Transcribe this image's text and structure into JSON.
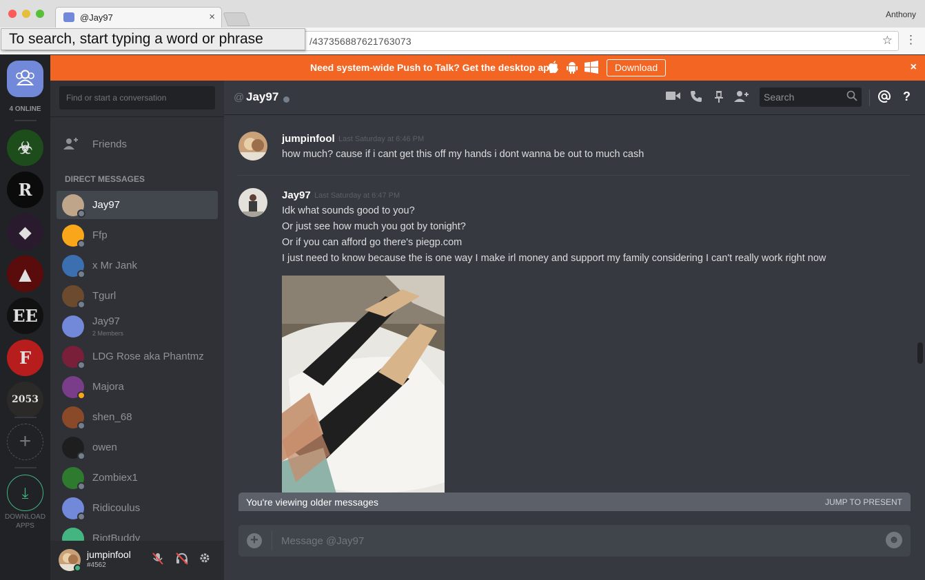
{
  "browser": {
    "tab_title": "@Jay97",
    "tab_close": "×",
    "profile_name": "Anthony",
    "url": "/437356887621763073",
    "find_tooltip": "To search, start typing a word or phrase",
    "star": "☆",
    "menu": "⋮"
  },
  "guilds": {
    "online_label": "4 ONLINE",
    "items": [
      {
        "name": "biohazard-guild",
        "color": "#1d4d1a",
        "glyph": "☣"
      },
      {
        "name": "r-guild",
        "color": "#0b0b0b",
        "glyph": "R"
      },
      {
        "name": "wolf-guild",
        "color": "#2a1a2e",
        "glyph": "◆"
      },
      {
        "name": "red-cape-guild",
        "color": "#5a0b0b",
        "glyph": "▲"
      },
      {
        "name": "ee-guild",
        "color": "#111111",
        "glyph": "EE"
      },
      {
        "name": "f-guild",
        "color": "#b81d1d",
        "glyph": "F"
      },
      {
        "name": "2053-guild",
        "color": "#2b2a28",
        "glyph": "2053"
      }
    ],
    "add_icon": "+",
    "download_icon": "⤓",
    "download_label_1": "DOWNLOAD",
    "download_label_2": "APPS"
  },
  "banner": {
    "text": "Need system-wide Push to Talk? Get the desktop app!",
    "download_label": "Download",
    "close": "×",
    "bg": "#f26522"
  },
  "sidebar": {
    "search_placeholder": "Find or start a conversation",
    "friends_label": "Friends",
    "dm_header": "DIRECT MESSAGES",
    "items": [
      {
        "name": "Jay97",
        "color": "#bfa58a",
        "status": "#747f8d",
        "active": true
      },
      {
        "name": "Ffp",
        "color": "#faa61a",
        "status": "#747f8d"
      },
      {
        "name": "x Mr Jank",
        "color": "#3b6fb0",
        "status": "#747f8d"
      },
      {
        "name": "Tgurl",
        "color": "#6b4a2e",
        "status": "#747f8d"
      },
      {
        "name": "Jay97",
        "sub": "2 Members",
        "color": "#7289da",
        "status": ""
      },
      {
        "name": "LDG Rose aka Phantmz",
        "color": "#7a1f3a",
        "status": "#747f8d"
      },
      {
        "name": "Majora",
        "color": "#7a3d8a",
        "status": "#faa61a"
      },
      {
        "name": "shen_68",
        "color": "#8a4a2a",
        "status": "#747f8d"
      },
      {
        "name": "owen",
        "color": "#1e1e1e",
        "status": "#747f8d"
      },
      {
        "name": "Zombiex1",
        "color": "#2e7a2e",
        "status": "#747f8d"
      },
      {
        "name": "Ridicoulus",
        "color": "#7289da",
        "status": "#747f8d"
      },
      {
        "name": "RiotBuddy",
        "color": "#43b581",
        "status": "#747f8d"
      }
    ]
  },
  "user_panel": {
    "username": "jumpinfool",
    "tag": "#4562",
    "status_color": "#43b581"
  },
  "header": {
    "at": "@",
    "title": "Jay97",
    "search_placeholder": "Search",
    "icons": [
      "video-icon",
      "phone-icon",
      "pin-icon",
      "add-member-icon",
      "mention-icon",
      "help-icon"
    ]
  },
  "messages": [
    {
      "author": "jumpinfool",
      "time": "Last Saturday at 6:46 PM",
      "lines": [
        "how much? cause if i cant get this off my hands i dont wanna be out to much cash"
      ]
    },
    {
      "author": "Jay97",
      "time": "Last Saturday at 6:47 PM",
      "lines": [
        "Idk what sounds good to you?",
        "Or just see how much you got by tonight?",
        "Or if you can afford go there's piegp.com",
        "I just need to know because the is one way I make irl money and support my family considering I can't really work right now"
      ]
    }
  ],
  "older_bar": {
    "text": "You're viewing older messages",
    "jump_label": "JUMP TO PRESENT"
  },
  "composer": {
    "placeholder": "Message @Jay97",
    "add_icon": "+",
    "emoji_icon": "☻"
  },
  "colors": {
    "accent": "#7289da",
    "online": "#43b581",
    "idle": "#faa61a",
    "offline": "#747f8d"
  }
}
